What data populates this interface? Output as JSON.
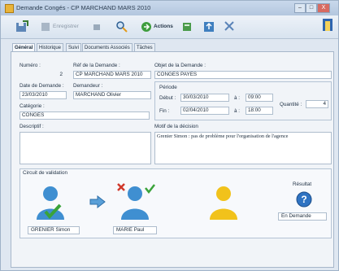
{
  "window": {
    "title": "Demande Congés - CP MARCHAND MARS 2010",
    "controls": [
      "–",
      "□",
      "X"
    ]
  },
  "toolbar": {
    "disabled_label": "Enregistrer",
    "actions_label": "Actions"
  },
  "tabs": [
    "Général",
    "Historique",
    "Suivi",
    "Documents Associés",
    "Tâches"
  ],
  "form": {
    "numero_label": "Numéro :",
    "numero_value": "2",
    "ref_label": "Réf de la Demande :",
    "ref_value": "CP MARCHAND MARS 2010",
    "objet_label": "Objet de la Demande :",
    "objet_value": "CONGES PAYES",
    "date_label": "Date de Demande :",
    "date_value": "23/03/2010",
    "demandeur_label": "Demandeur :",
    "demandeur_value": "MARCHAND Olivier",
    "categorie_label": "Catégorie :",
    "categorie_value": "CONGES",
    "periode_label": "Période",
    "debut_label": "Début :",
    "debut_date": "30/03/2010",
    "a_label_1": "à :",
    "debut_time": "09:00",
    "fin_label": "Fin :",
    "fin_date": "02/04/2010",
    "a_label_2": "à :",
    "fin_time": "18:00",
    "quantite_label": "Quantité :",
    "quantite_value": "4",
    "descriptif_label": "Descriptif :",
    "descriptif_value": "",
    "motif_label": "Motif de la décision",
    "motif_value": "Grenier Simon : pas de problème pour l'organisation de l'agence"
  },
  "circuit": {
    "title": "Circuit de validation",
    "validators": [
      {
        "name": "GRENIER Simon",
        "status_icon": "check-icon"
      },
      {
        "name": "MARIE Paul",
        "status_icon": "check-cross-icon"
      }
    ],
    "resultat_label": "Résultat",
    "resultat_value": "En Demande",
    "colors": {
      "blue_person": "#3f8fd1",
      "gold_person": "#f1c21b",
      "check": "#3aa33a",
      "cross": "#d0392b"
    }
  }
}
